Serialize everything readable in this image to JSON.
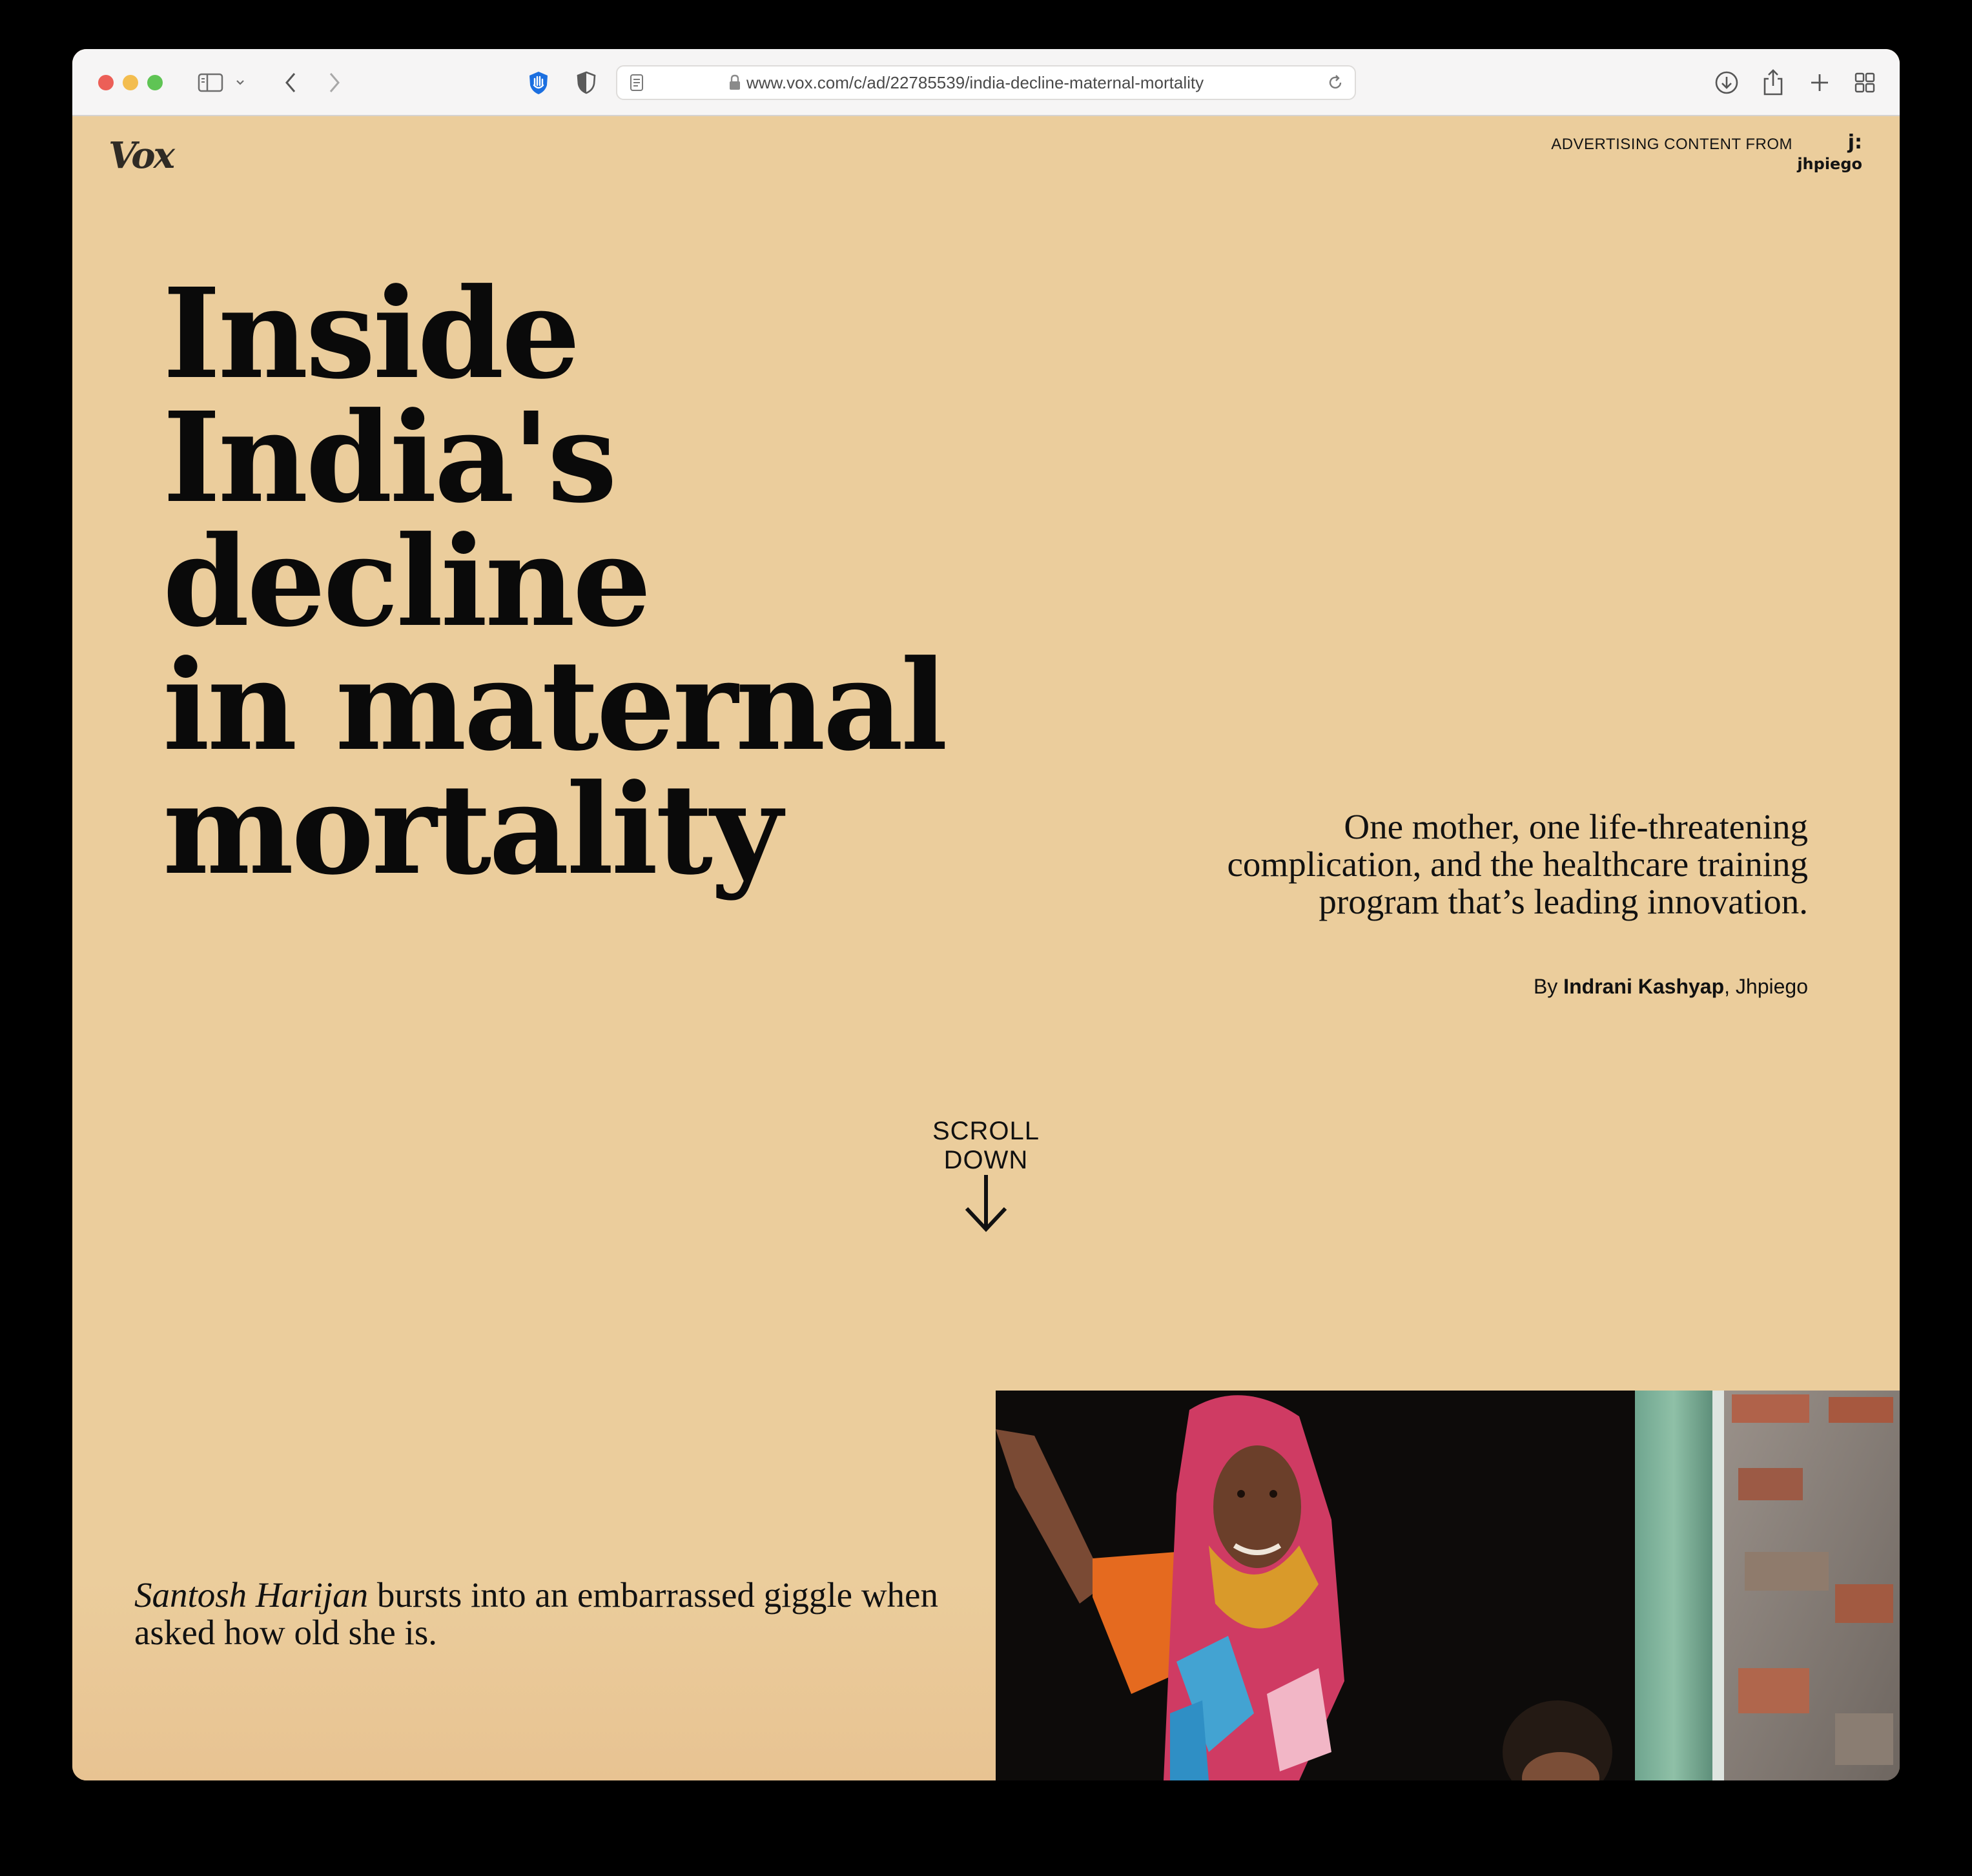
{
  "browser": {
    "url": "www.vox.com/c/ad/22785539/india-decline-maternal-mortality"
  },
  "site": {
    "logo_text": "Vox",
    "ad_label": "ADVERTISING CONTENT FROM",
    "sponsor_mark": "j:",
    "sponsor_name": "jhpiego"
  },
  "article": {
    "headline_lines": [
      "Inside",
      "India's",
      "decline",
      "in maternal",
      "mortality"
    ],
    "dek": "One mother, one life-threatening complication, and the healthcare training program that’s leading innovation.",
    "byline": {
      "prefix": "By ",
      "author": "Indrani Kashyap",
      "org": ", Jhpiego"
    },
    "scroll_label": "SCROLL DOWN",
    "lead": {
      "name": "Santosh Harijan",
      "text": " bursts into an embarrassed giggle when asked how old she is."
    }
  },
  "colors": {
    "page_background": "#ebcd9c",
    "text": "#0a0a0a"
  }
}
